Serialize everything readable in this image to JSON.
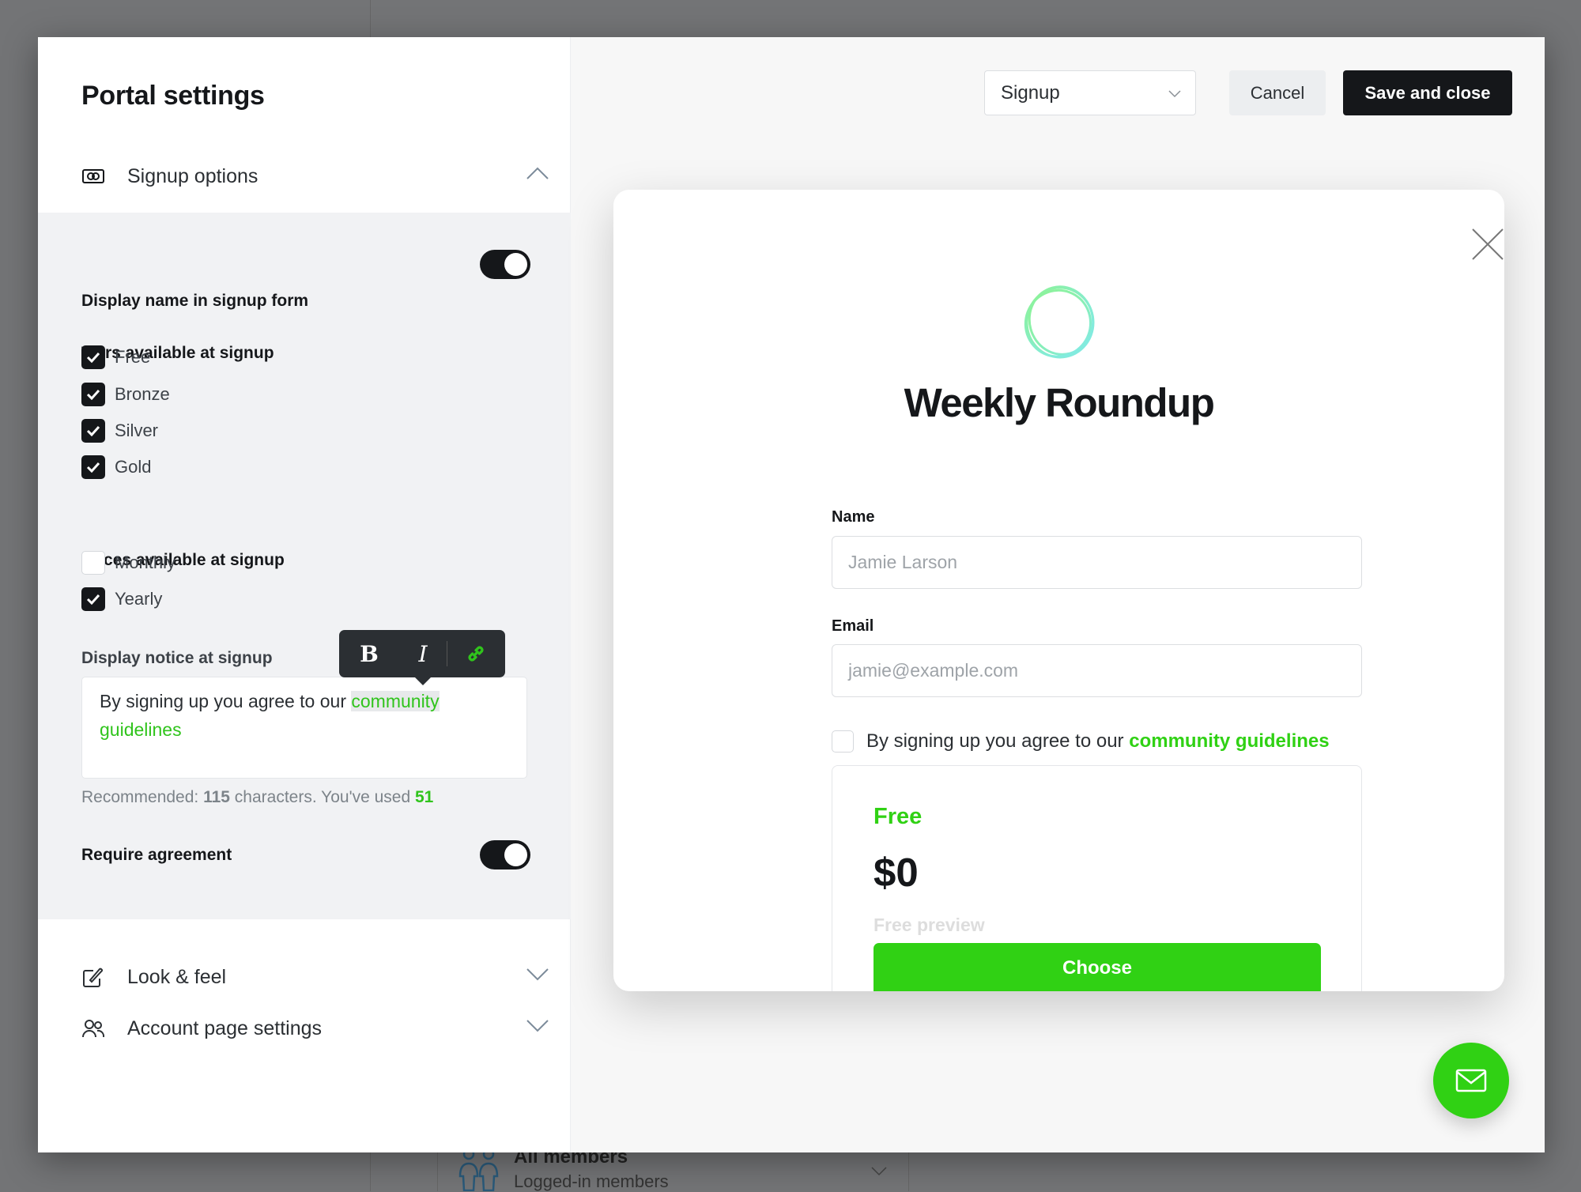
{
  "background": {
    "list_item_title": "All members",
    "list_item_subtitle": "Logged-in members"
  },
  "sidebar": {
    "title": "Portal settings",
    "signup_options": {
      "label": "Signup options",
      "expanded": true,
      "display_name_label": "Display name in signup form",
      "display_name_on": true,
      "tiers_label": "Tiers available at signup",
      "tiers": [
        {
          "label": "Free",
          "checked": true
        },
        {
          "label": "Bronze",
          "checked": true
        },
        {
          "label": "Silver",
          "checked": true
        },
        {
          "label": "Gold",
          "checked": true
        }
      ],
      "prices_label": "Prices available at signup",
      "prices": [
        {
          "label": "Monthly",
          "checked": false
        },
        {
          "label": "Yearly",
          "checked": true
        }
      ],
      "notice_label": "Display notice at signup",
      "notice_text": "By signing up you agree to our ",
      "notice_link_1": "community",
      "notice_link_2": "guidelines",
      "toolbar": {
        "bold": "B",
        "italic": "I",
        "link_icon": "link-icon"
      },
      "rec_prefix": "Recommended: ",
      "rec_count": "115",
      "rec_mid": " characters. You've used ",
      "rec_used": "51",
      "require_label": "Require agreement",
      "require_on": true
    },
    "look_feel": "Look & feel",
    "account_page": "Account page settings"
  },
  "header": {
    "page_select": "Signup",
    "cancel": "Cancel",
    "save": "Save and close"
  },
  "preview": {
    "site_title": "Weekly Roundup",
    "name_label": "Name",
    "name_placeholder": "Jamie Larson",
    "email_label": "Email",
    "email_placeholder": "jamie@example.com",
    "agree_text": "By signing up you agree to our ",
    "agree_link": "community guidelines",
    "tier": {
      "name": "Free",
      "price": "$0",
      "description": "Free preview",
      "button": "Choose"
    }
  },
  "colors": {
    "accent": "#30d114",
    "dark": "#15171a",
    "panel": "#f1f2f4"
  }
}
